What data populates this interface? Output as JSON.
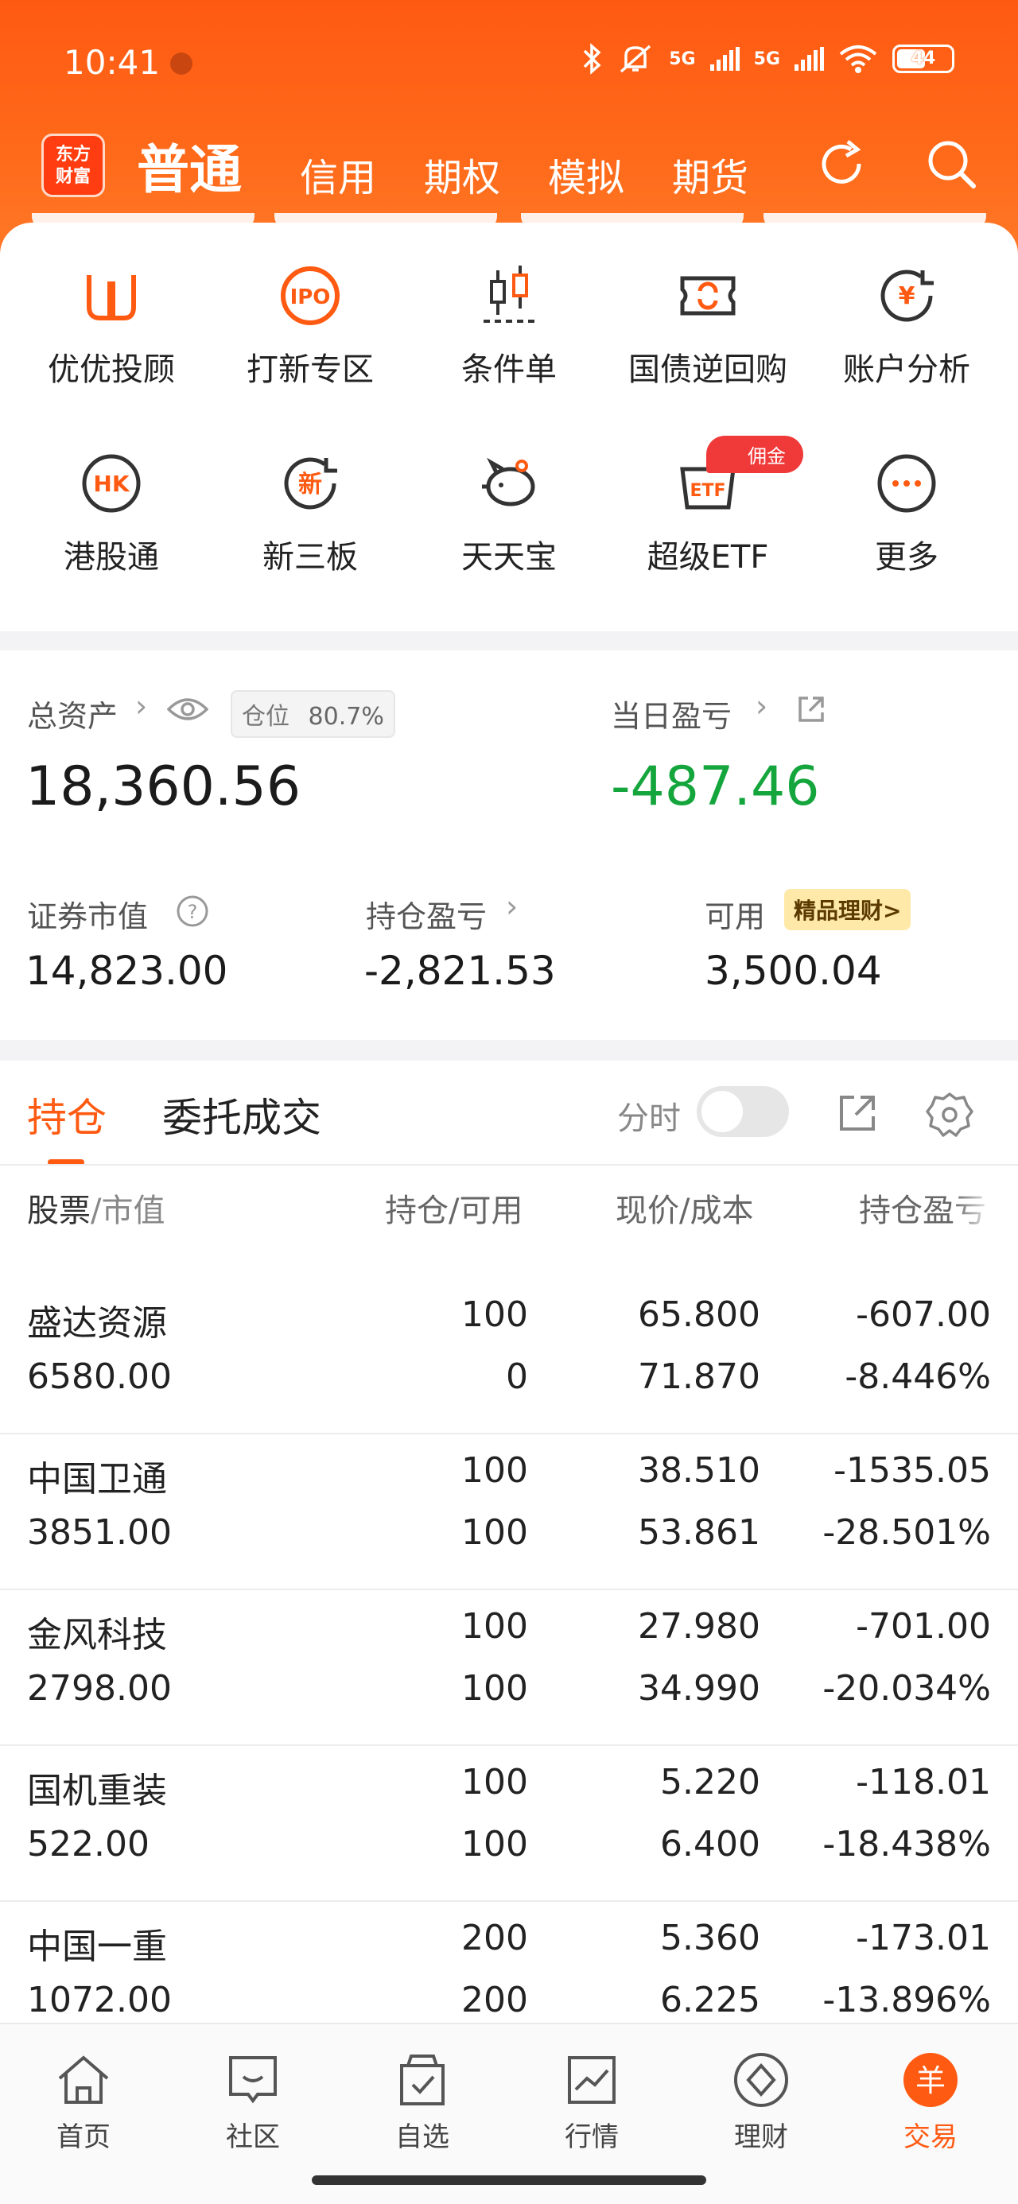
{
  "status_bar": {
    "time": "10:41",
    "signal_label_1": "5G",
    "signal_label_2": "5G",
    "battery": "44"
  },
  "top_nav": {
    "logo_line1": "东方",
    "logo_line2": "财富",
    "active_tab": "普通",
    "tabs": [
      "信用",
      "期权",
      "模拟",
      "期货"
    ]
  },
  "feature_grid": [
    {
      "label": "优优投顾",
      "icon": "uu-advisor-icon"
    },
    {
      "label": "打新专区",
      "icon": "ipo-icon"
    },
    {
      "label": "条件单",
      "icon": "candlestick-icon"
    },
    {
      "label": "国债逆回购",
      "icon": "repo-icon"
    },
    {
      "label": "账户分析",
      "icon": "account-analysis-icon"
    },
    {
      "label": "港股通",
      "icon": "hk-icon"
    },
    {
      "label": "新三板",
      "icon": "xin-icon"
    },
    {
      "label": "天天宝",
      "icon": "piggy-bank-icon"
    },
    {
      "label": "超级ETF",
      "icon": "etf-icon"
    },
    {
      "label": "更多",
      "icon": "more-icon"
    }
  ],
  "etf_badge": "佣金",
  "assets": {
    "total_label": "总资产",
    "position_chip_label": "仓位",
    "position_pct": "80.7%",
    "total_value": "18,360.56",
    "daily_pl_label": "当日盈亏",
    "daily_pl_value": "-487.46",
    "market_value_label": "证券市值",
    "market_value": "14,823.00",
    "hold_pl_label": "持仓盈亏",
    "hold_pl_value": "-2,821.53",
    "available_label": "可用",
    "wealth_chip": "精品理财>",
    "available_value": "3,500.04"
  },
  "holdings": {
    "tab_active": "持仓",
    "tab_other": "委托成交",
    "timeshare_label": "分时",
    "headers": {
      "stock_a": "股票",
      "stock_b": "/市值",
      "hold": "持仓/可用",
      "price": "现价/成本",
      "pl": "持仓盈亏"
    },
    "rows": [
      {
        "name": "盛达资源",
        "value": "6580.00",
        "hold": "100",
        "avail": "0",
        "price": "65.800",
        "cost": "71.870",
        "pl": "-607.00",
        "pl_pct": "-8.446%"
      },
      {
        "name": "中国卫通",
        "value": "3851.00",
        "hold": "100",
        "avail": "100",
        "price": "38.510",
        "cost": "53.861",
        "pl": "-1535.05",
        "pl_pct": "-28.501%"
      },
      {
        "name": "金风科技",
        "value": "2798.00",
        "hold": "100",
        "avail": "100",
        "price": "27.980",
        "cost": "34.990",
        "pl": "-701.00",
        "pl_pct": "-20.034%"
      },
      {
        "name": "国机重装",
        "value": "522.00",
        "hold": "100",
        "avail": "100",
        "price": "5.220",
        "cost": "6.400",
        "pl": "-118.01",
        "pl_pct": "-18.438%"
      },
      {
        "name": "中国一重",
        "value": "1072.00",
        "hold": "200",
        "avail": "200",
        "price": "5.360",
        "cost": "6.225",
        "pl": "-173.01",
        "pl_pct": "-13.896%"
      }
    ]
  },
  "bottom_nav": [
    {
      "label": "首页",
      "icon": "home-icon"
    },
    {
      "label": "社区",
      "icon": "community-icon"
    },
    {
      "label": "自选",
      "icon": "watchlist-icon"
    },
    {
      "label": "行情",
      "icon": "market-icon"
    },
    {
      "label": "理财",
      "icon": "wealth-icon"
    },
    {
      "label": "交易",
      "icon": "trade-icon"
    }
  ],
  "colors": {
    "brand_orange": "#ff5a12",
    "loss_green": "#14a53c"
  }
}
